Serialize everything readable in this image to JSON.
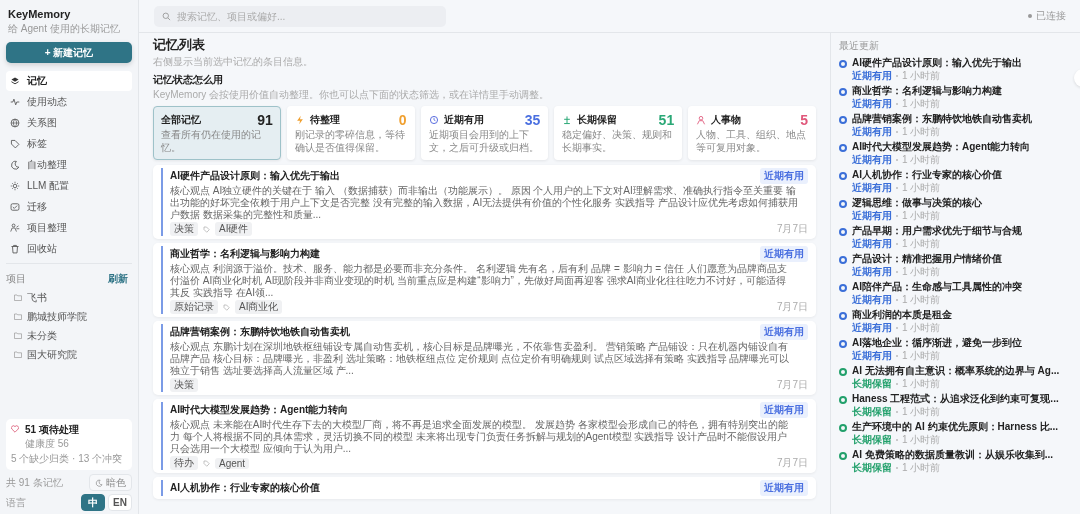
{
  "app": {
    "name": "KeyMemory",
    "tagline": "给 Agent 使用的长期记忆"
  },
  "new_button": {
    "label": "新建记忆",
    "icon": "+"
  },
  "nav": [
    {
      "label": "记忆",
      "selected": true
    },
    {
      "label": "使用动态",
      "selected": false
    },
    {
      "label": "关系图",
      "selected": false
    },
    {
      "label": "标签",
      "selected": false
    },
    {
      "label": "自动整理",
      "selected": false
    },
    {
      "label": "LLM 配置",
      "selected": false
    },
    {
      "label": "迁移",
      "selected": false
    },
    {
      "label": "项目整理",
      "selected": false
    },
    {
      "label": "回收站",
      "selected": false
    }
  ],
  "projects": {
    "title": "项目",
    "action": "刷新",
    "items": [
      "飞书",
      "鹏城技师学院",
      "未分类",
      "国大研究院"
    ]
  },
  "health": {
    "title": "51 项待处理",
    "score": "健康度 56",
    "detail": "5 个缺少归类 · 13 个冲突"
  },
  "footer": {
    "count": "共 91 条记忆",
    "theme_button": "暗色",
    "language_label": "语言",
    "languages": [
      {
        "label": "中",
        "selected": true
      },
      {
        "label": "EN",
        "selected": false
      }
    ]
  },
  "search": {
    "placeholder": "搜索记忆、项目或偏好..."
  },
  "connection": {
    "label": "已连接"
  },
  "page": {
    "title": "记忆列表",
    "subtitle": "右侧显示当前选中记忆的条目信息。",
    "section_title": "记忆状态怎么用",
    "section_desc": "KeyMemory 会按使用价值自动整理。你也可以点下面的状态筛选，或在详情里手动调整。"
  },
  "status_cards": [
    {
      "kind": "all",
      "label": "全部记忆",
      "count": "91",
      "desc": "查看所有仍在使用的记忆。",
      "selected": true
    },
    {
      "kind": "pending",
      "label": "待整理",
      "count": "0",
      "desc": "刚记录的零碎信息，等待确认是否值得保留。",
      "selected": false
    },
    {
      "kind": "recent",
      "label": "近期有用",
      "count": "35",
      "desc": "近期项目会用到的上下文，之后可升级或归档。",
      "selected": false
    },
    {
      "kind": "long",
      "label": "长期保留",
      "count": "51",
      "desc": "稳定偏好、决策、规则和长期事实。",
      "selected": false
    },
    {
      "kind": "entity",
      "label": "人事物",
      "count": "5",
      "desc": "人物、工具、组织、地点等可复用对象。",
      "selected": false
    }
  ],
  "memories": [
    {
      "title": "AI硬件产品设计原则：输入优先于输出",
      "status": "近期有用",
      "body": "核心观点 AI独立硬件的关键在于 输入 （数据捕获）而非输出（功能展示）。 原因 个人用户的上下文对AI理解需求、准确执行指令至关重要 输出功能的好坏完全依赖于用户上下文是否完整 没有完整的输入数据，AI无法提供有价值的个性化服务 实践指导 产品设计应优先考虑如何捕获用户数据 数据采集的完整性和质量...",
      "type": "决策",
      "tags": [
        "AI硬件"
      ],
      "date": "7月7日"
    },
    {
      "title": "商业哲学：名利逻辑与影响力构建",
      "status": "近期有用",
      "body": "核心观点 利润源于溢价。技术、服务、能力都是必要而非充分条件。 名利逻辑 先有名，后有利 品牌 = 影响力 = 信任 人们愿意为品牌商品支付溢价 AI商业化时机 AI现阶段并非商业变现的时机 当前重点应是构建“影响力”，先做好局面再迎客 强求AI商业化往往吃力不讨好，可能适得其反 实践指导 在AI领...",
      "type": "原始记录",
      "tags": [
        "AI商业化"
      ],
      "date": "7月7日"
    },
    {
      "title": "品牌营销案例：东鹏特饮地铁自动售卖机",
      "status": "近期有用",
      "body": "核心观点 东鹏计划在深圳地铁枢纽铺设专属自动售卖机，核心目标是品牌曝光，不依靠售卖盈利。 营销策略 产品铺设：只在机器内铺设自有品牌产品 核心目标：品牌曝光，非盈利 选址策略：地铁枢纽点位 定价规则 点位定价有明确规则 试点区域选择有策略 实践指导 品牌曝光可以独立于销售 选址要选择高人流量区域 产...",
      "type": "决策",
      "date": "7月7日"
    },
    {
      "title": "AI时代大模型发展趋势：Agent能力转向",
      "status": "近期有用",
      "body": "核心观点 未来能在AI时代生存下去的大模型厂商，将不再是追求全面发展的模型。 发展趋势 各家模型会形成自己的特色，拥有特别突出的能力 每个人将根据不同的具体需求，灵活切换不同的模型 未来将出现专门负责任务拆解与规划的Agent模型 实践指导 设计产品时不能假设用户只会选用一个大模型 应倾向于认为用户...",
      "type": "待办",
      "tags": [
        "Agent"
      ],
      "date": "7月7日"
    },
    {
      "title": "AI人机协作：行业专家的核心价值",
      "status": "近期有用"
    }
  ],
  "recent": {
    "title": "最近更新",
    "items": [
      {
        "title": "AI硬件产品设计原则：输入优先于输出",
        "status": "近期有用",
        "time": "1 小时前",
        "color": "#3b6fd8"
      },
      {
        "title": "商业哲学：名利逻辑与影响力构建",
        "status": "近期有用",
        "time": "1 小时前",
        "color": "#3b6fd8"
      },
      {
        "title": "品牌营销案例：东鹏特饮地铁自动售卖机",
        "status": "近期有用",
        "time": "1 小时前",
        "color": "#3b6fd8"
      },
      {
        "title": "AI时代大模型发展趋势：Agent能力转向",
        "status": "近期有用",
        "time": "1 小时前",
        "color": "#3b6fd8"
      },
      {
        "title": "AI人机协作：行业专家的核心价值",
        "status": "近期有用",
        "time": "1 小时前",
        "color": "#3b6fd8"
      },
      {
        "title": "逻辑思维：做事与决策的核心",
        "status": "近期有用",
        "time": "1 小时前",
        "color": "#3b6fd8"
      },
      {
        "title": "产品早期：用户需求优先于细节与合规",
        "status": "近期有用",
        "time": "1 小时前",
        "color": "#3b6fd8"
      },
      {
        "title": "产品设计：精准把握用户情绪价值",
        "status": "近期有用",
        "time": "1 小时前",
        "color": "#3b6fd8"
      },
      {
        "title": "AI陪伴产品：生命感与工具属性的冲突",
        "status": "近期有用",
        "time": "1 小时前",
        "color": "#3b6fd8"
      },
      {
        "title": "商业利润的本质是租金",
        "status": "近期有用",
        "time": "1 小时前",
        "color": "#3b6fd8"
      },
      {
        "title": "AI落地企业：循序渐进，避免一步到位",
        "status": "近期有用",
        "time": "1 小时前",
        "color": "#3b6fd8"
      },
      {
        "title": "AI 无法拥有自主意识：概率系统的边界与 Ag...",
        "status": "长期保留",
        "time": "1 小时前",
        "color": "#22a06b"
      },
      {
        "title": "Haness 工程范式：从追求泛化到约束可复现...",
        "status": "长期保留",
        "time": "1 小时前",
        "color": "#22a06b"
      },
      {
        "title": "生产环境中的 AI 约束优先原则：Harness 比...",
        "status": "长期保留",
        "time": "1 小时前",
        "color": "#22a06b"
      },
      {
        "title": "AI 免费策略的数据质量教训：从娱乐收集到...",
        "status": "长期保留",
        "time": "1 小时前",
        "color": "#22a06b"
      }
    ]
  }
}
